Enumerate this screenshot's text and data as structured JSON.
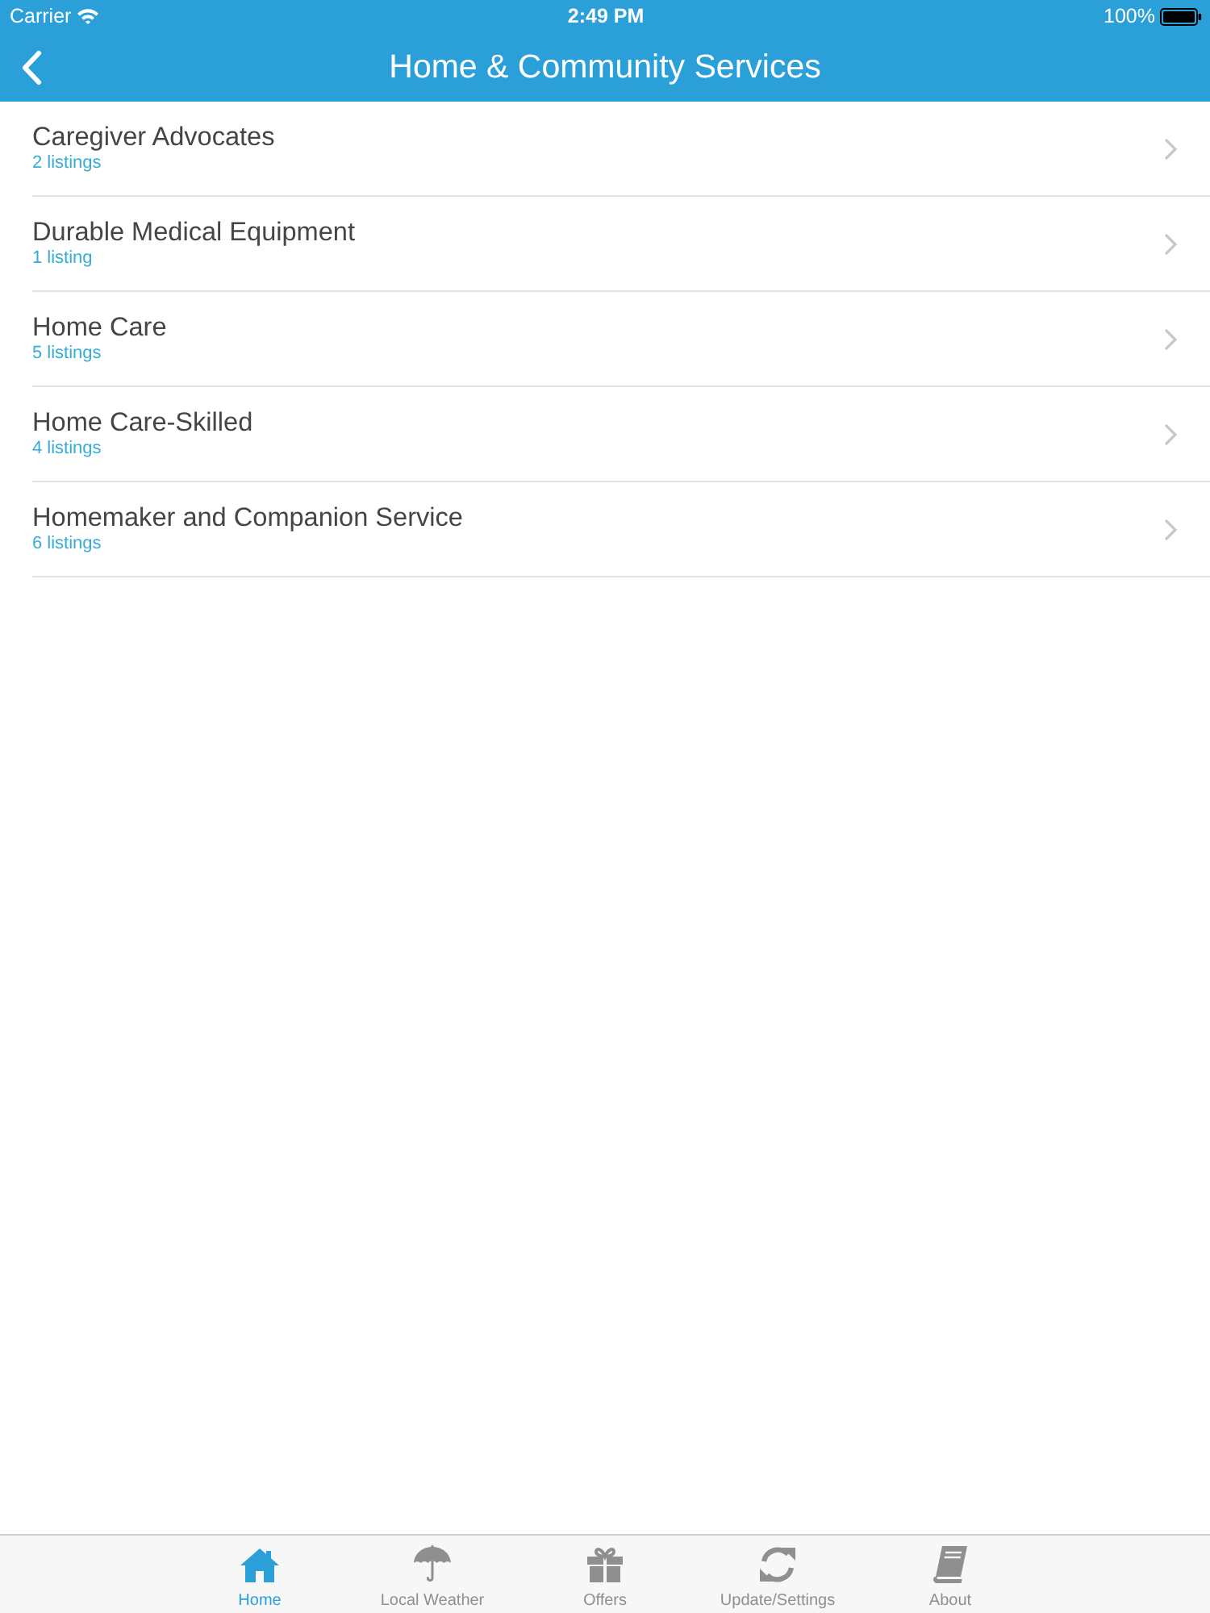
{
  "status_bar": {
    "carrier": "Carrier",
    "time": "2:49 PM",
    "battery": "100%"
  },
  "nav_bar": {
    "title": "Home & Community Services"
  },
  "categories": [
    {
      "name": "Caregiver Advocates",
      "count": "2 listings"
    },
    {
      "name": "Durable Medical Equipment",
      "count": "1 listing"
    },
    {
      "name": "Home Care",
      "count": "5 listings"
    },
    {
      "name": "Home Care-Skilled",
      "count": "4 listings"
    },
    {
      "name": "Homemaker and Companion Service",
      "count": "6 listings"
    }
  ],
  "tab_bar": {
    "tabs": [
      {
        "label": "Home",
        "selected": true
      },
      {
        "label": "Local Weather",
        "selected": false
      },
      {
        "label": "Offers",
        "selected": false
      },
      {
        "label": "Update/Settings",
        "selected": false
      },
      {
        "label": "About",
        "selected": false
      }
    ]
  }
}
